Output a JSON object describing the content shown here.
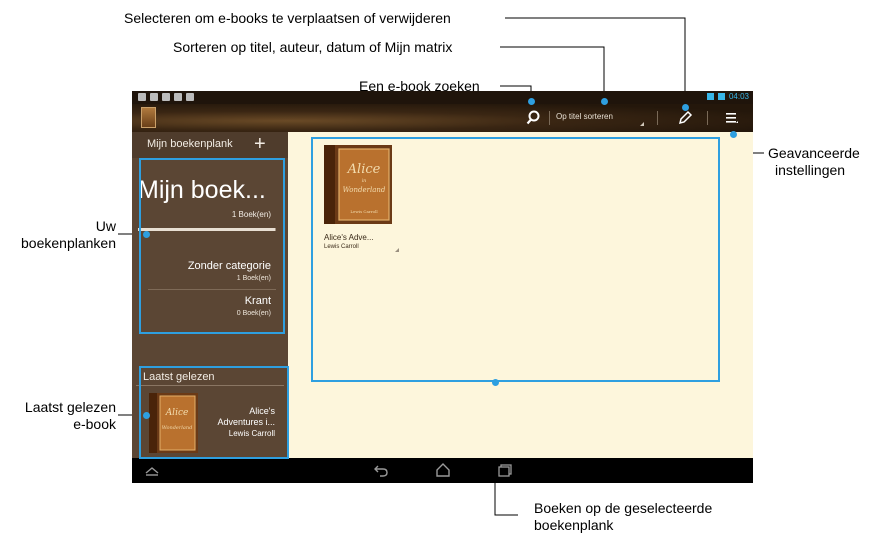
{
  "callouts": {
    "select": "Selecteren om e-books te verplaatsen of verwijderen",
    "sort": "Sorteren op titel, auteur, datum of Mijn matrix",
    "search": "Een e-book zoeken",
    "advanced_line1": "Geavanceerde",
    "advanced_line2": "instellingen",
    "shelves_line1": "Uw",
    "shelves_line2": "boekenplanken",
    "last_read_line1": "Laatst gelezen",
    "last_read_line2": "e-book",
    "books_line1": "Boeken op de geselecteerde",
    "books_line2": "boekenplank"
  },
  "statusbar": {
    "time": "04:03"
  },
  "actionbar": {
    "sort_label": "Op titel sorteren"
  },
  "sidebar": {
    "header": "Mijn boekenplank",
    "add_symbol": "+",
    "current_shelf": {
      "name": "Mijn boek...",
      "count": "1 Boek(en)",
      "progress": 0.99
    },
    "categories": [
      {
        "name": "Zonder categorie",
        "count": "1 Boek(en)"
      },
      {
        "name": "Krant",
        "count": "0 Boek(en)"
      }
    ],
    "recent": {
      "header": "Laatst gelezen",
      "title_line1": "Alice's",
      "title_line2": "Adventures i...",
      "author": "Lewis Carroll"
    }
  },
  "main": {
    "books": [
      {
        "title": "Alice's Adve...",
        "author": "Lewis Carroll"
      }
    ]
  },
  "colors": {
    "callout": "#2e9fe0",
    "status_accent": "#38b6e8",
    "main_bg": "#fdf6dc",
    "panel_bg": "#5b4634"
  },
  "icons": {
    "search": "search-icon",
    "edit": "pencil-icon",
    "menu": "menu-icon",
    "nav": [
      "collapse-icon",
      "back-icon",
      "home-icon",
      "recent-apps-icon"
    ]
  }
}
